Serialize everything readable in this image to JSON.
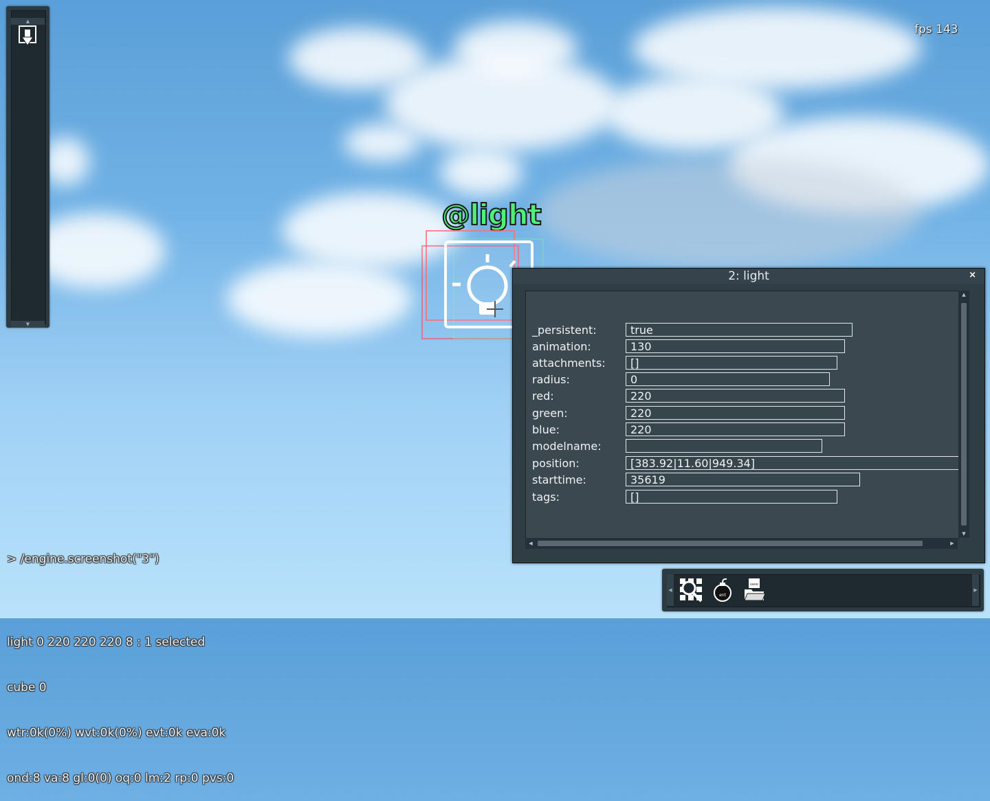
{
  "hud": {
    "fps": "fps 143"
  },
  "world": {
    "entity_label": "@light"
  },
  "panel": {
    "title": "2: light",
    "close": "×",
    "properties": [
      {
        "label": "_persistent:",
        "value": "true"
      },
      {
        "label": "animation:",
        "value": "130"
      },
      {
        "label": "attachments:",
        "value": "[]"
      },
      {
        "label": "radius:",
        "value": "0"
      },
      {
        "label": "red:",
        "value": "220"
      },
      {
        "label": "green:",
        "value": "220"
      },
      {
        "label": "blue:",
        "value": "220"
      },
      {
        "label": "modelname:",
        "value": ""
      },
      {
        "label": "position:",
        "value": "[383.92|11.60|949.34]"
      },
      {
        "label": "starttime:",
        "value": "35619"
      },
      {
        "label": "tags:",
        "value": "[]"
      }
    ]
  },
  "console": {
    "command": "> /engine.screenshot(\"3\")",
    "lines": [
      "light 0 220 220 220 8 : 1 selected",
      "cube 0",
      "wtr:0k(0%) wvt:0k(0%) evt:0k eva:0k",
      "ond:8 va:8 gl:0(0) oq:0 lm:2 rp:0 pvs:0"
    ]
  },
  "toolbar": {
    "icons": [
      "entity-browser-icon",
      "bomb-icon",
      "save-folder-icon"
    ],
    "save_text": "save",
    "bomb_text": "ent"
  }
}
